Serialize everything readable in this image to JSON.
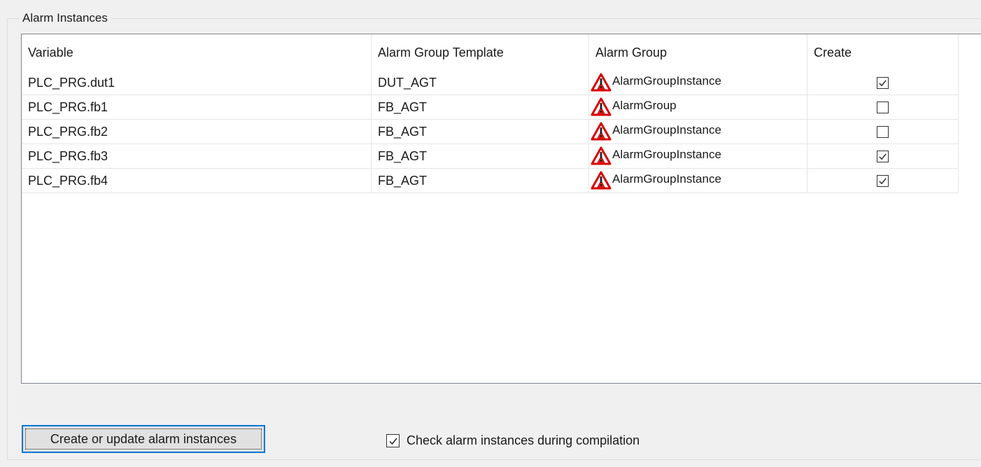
{
  "group_title": "Alarm Instances",
  "table": {
    "headers": [
      "Variable",
      "Alarm Group Template",
      "Alarm Group",
      "Create"
    ],
    "rows": [
      {
        "variable": "PLC_PRG.dut1",
        "template": "DUT_AGT",
        "alarm_group": "AlarmGroupInstance",
        "alarm_group_icon": "warning-icon",
        "create": true
      },
      {
        "variable": "PLC_PRG.fb1",
        "template": "FB_AGT",
        "alarm_group": "AlarmGroup",
        "alarm_group_icon": "warning-icon",
        "create": false
      },
      {
        "variable": "PLC_PRG.fb2",
        "template": "FB_AGT",
        "alarm_group": "AlarmGroupInstance",
        "alarm_group_icon": "warning-icon",
        "create": false
      },
      {
        "variable": "PLC_PRG.fb3",
        "template": "FB_AGT",
        "alarm_group": "AlarmGroupInstance",
        "alarm_group_icon": "warning-icon",
        "create": true
      },
      {
        "variable": "PLC_PRG.fb4",
        "template": "FB_AGT",
        "alarm_group": "AlarmGroupInstance",
        "alarm_group_icon": "warning-icon",
        "create": true
      }
    ]
  },
  "buttons": {
    "create_update_label": "Create or update alarm instances"
  },
  "options": {
    "check_during_compilation": {
      "label": "Check alarm instances during compilation",
      "checked": true
    }
  },
  "colors": {
    "warning_red": "#d80000",
    "focus_blue": "#0078d7"
  }
}
